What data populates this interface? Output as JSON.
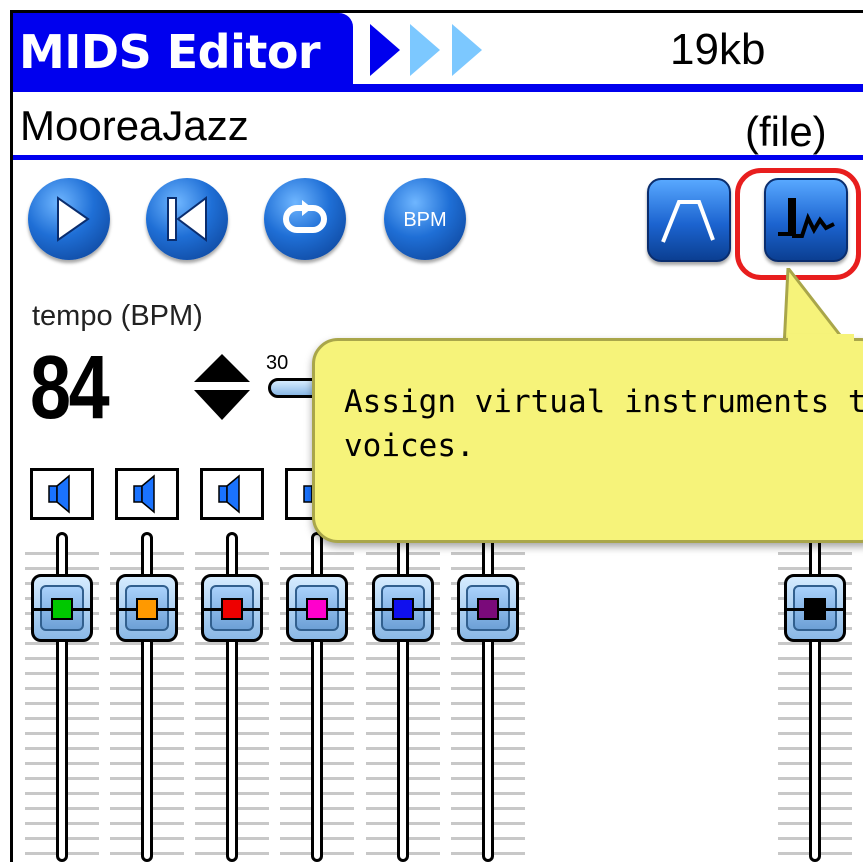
{
  "header": {
    "app_title": "MIDS Editor",
    "file_size": "19kb",
    "file_name": "MooreaJazz",
    "file_type": "(file)",
    "colors": {
      "header_blue": "#0000ee",
      "highlight_red": "#e81e1e",
      "tooltip_yellow": "#f6f37a"
    }
  },
  "transport": {
    "buttons": [
      {
        "icon": "play-icon"
      },
      {
        "icon": "rewind-icon"
      },
      {
        "icon": "loop-icon"
      },
      {
        "icon": "bpm-icon",
        "label": "BPM"
      }
    ],
    "right_buttons": [
      {
        "icon": "envelope-icon"
      },
      {
        "icon": "waveform-icon",
        "highlighted": true
      }
    ]
  },
  "tempo": {
    "label": "tempo (BPM)",
    "value": "84",
    "slider_min": "30"
  },
  "tooltip": {
    "text": "Assign virtual instruments to\nvoices."
  },
  "channels": [
    {
      "color": "#00c800"
    },
    {
      "color": "#ff9900"
    },
    {
      "color": "#ee0000"
    },
    {
      "color": "#ff00cc"
    },
    {
      "color": "#1010ee"
    },
    {
      "color": "#7a0a7a"
    },
    {
      "color": "#000000"
    }
  ]
}
